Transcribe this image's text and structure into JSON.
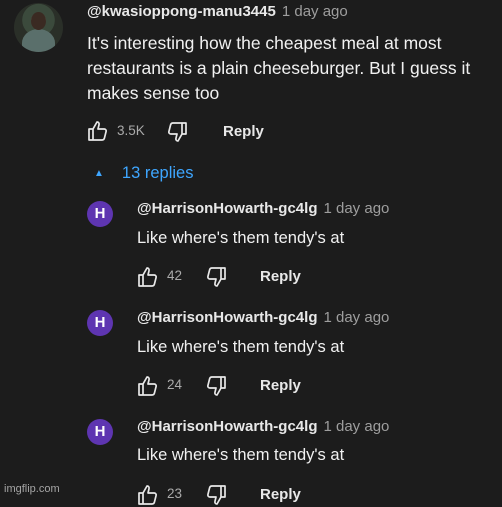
{
  "comment": {
    "author": "@kwasioppong-manu3445",
    "time": "1 day ago",
    "lines": [
      "It's interesting how the cheapest meal at most",
      "restaurants is a plain cheeseburger. But I guess it",
      "makes sense too"
    ],
    "likes": "3.5K",
    "reply_label": "Reply"
  },
  "replies_toggle": {
    "label": "13 replies",
    "icon": "caret-up-icon"
  },
  "replies": [
    {
      "avatar_letter": "H",
      "author": "@HarrisonHowarth-gc4lg",
      "time": "1 day ago",
      "text": "Like where's them tendy's at",
      "likes": "42",
      "reply_label": "Reply"
    },
    {
      "avatar_letter": "H",
      "author": "@HarrisonHowarth-gc4lg",
      "time": "1 day ago",
      "text": "Like where's them tendy's at",
      "likes": "24",
      "reply_label": "Reply"
    },
    {
      "avatar_letter": "H",
      "author": "@HarrisonHowarth-gc4lg",
      "time": "1 day ago",
      "text": "Like where's them tendy's at",
      "likes": "23",
      "reply_label": "Reply"
    }
  ],
  "watermark": "imgflip.com",
  "colors": {
    "background": "#1c1c1c",
    "link_blue": "#3ea6ff",
    "avatar_purple": "#5e35b1"
  }
}
